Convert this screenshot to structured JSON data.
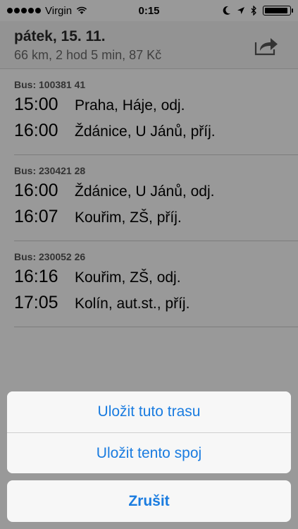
{
  "status_bar": {
    "carrier": "Virgin",
    "time": "0:15"
  },
  "header": {
    "date": "pátek, 15. 11.",
    "summary": "66 km, 2 hod 5 min, 87 Kč"
  },
  "trips": [
    {
      "title": "Bus: 100381 41",
      "stops": [
        {
          "time": "15:00",
          "name": "Praha, Háje, odj."
        },
        {
          "time": "16:00",
          "name": "Ždánice, U Jánů, příj."
        }
      ]
    },
    {
      "title": "Bus: 230421 28",
      "stops": [
        {
          "time": "16:00",
          "name": "Ždánice, U Jánů, odj."
        },
        {
          "time": "16:07",
          "name": "Kouřim, ZŠ, příj."
        }
      ]
    },
    {
      "title": "Bus: 230052 26",
      "stops": [
        {
          "time": "16:16",
          "name": "Kouřim, ZŠ, odj."
        },
        {
          "time": "17:05",
          "name": "Kolín, aut.st., příj."
        }
      ]
    }
  ],
  "action_sheet": {
    "save_route": "Uložit tuto trasu",
    "save_connection": "Uložit tento spoj",
    "cancel": "Zrušit"
  },
  "colors": {
    "accent": "#1a7ce0"
  }
}
